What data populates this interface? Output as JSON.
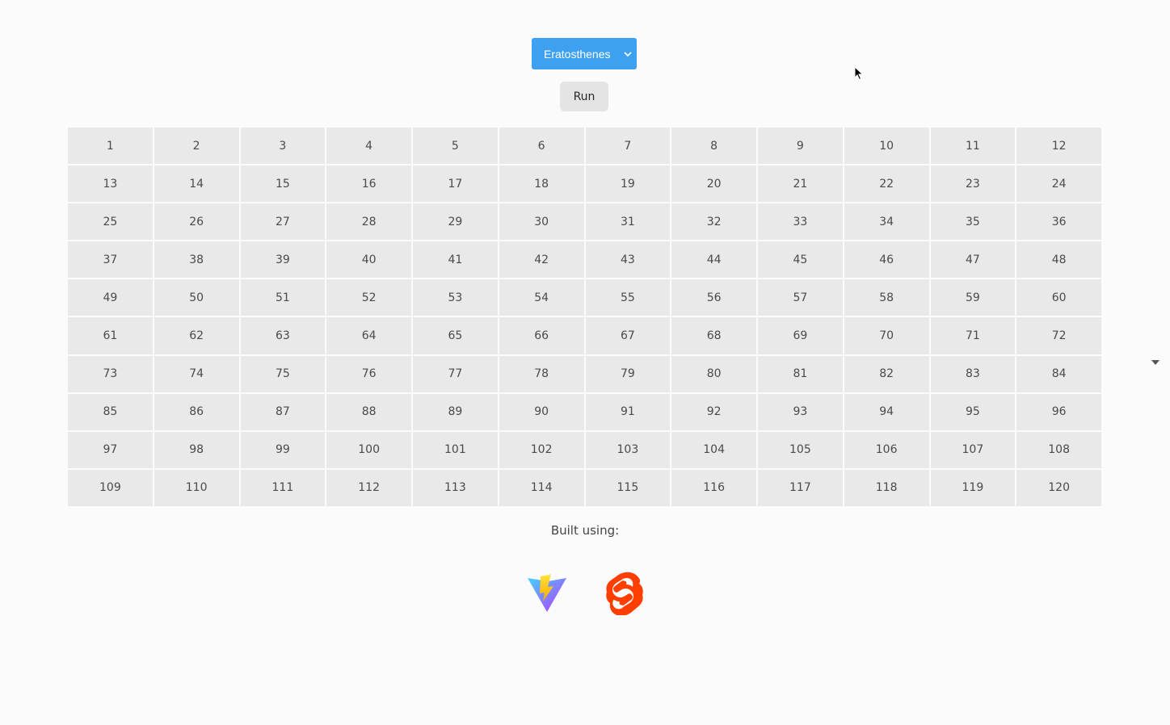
{
  "controls": {
    "algorithm_selected": "Eratosthenes",
    "run_label": "Run",
    "select_color": "#3da0f0"
  },
  "grid": {
    "numbers": [
      "1",
      "2",
      "3",
      "4",
      "5",
      "6",
      "7",
      "8",
      "9",
      "10",
      "11",
      "12",
      "13",
      "14",
      "15",
      "16",
      "17",
      "18",
      "19",
      "20",
      "21",
      "22",
      "23",
      "24",
      "25",
      "26",
      "27",
      "28",
      "29",
      "30",
      "31",
      "32",
      "33",
      "34",
      "35",
      "36",
      "37",
      "38",
      "39",
      "40",
      "41",
      "42",
      "43",
      "44",
      "45",
      "46",
      "47",
      "48",
      "49",
      "50",
      "51",
      "52",
      "53",
      "54",
      "55",
      "56",
      "57",
      "58",
      "59",
      "60",
      "61",
      "62",
      "63",
      "64",
      "65",
      "66",
      "67",
      "68",
      "69",
      "70",
      "71",
      "72",
      "73",
      "74",
      "75",
      "76",
      "77",
      "78",
      "79",
      "80",
      "81",
      "82",
      "83",
      "84",
      "85",
      "86",
      "87",
      "88",
      "89",
      "90",
      "91",
      "92",
      "93",
      "94",
      "95",
      "96",
      "97",
      "98",
      "99",
      "100",
      "101",
      "102",
      "103",
      "104",
      "105",
      "106",
      "107",
      "108",
      "109",
      "110",
      "111",
      "112",
      "113",
      "114",
      "115",
      "116",
      "117",
      "118",
      "119",
      "120"
    ]
  },
  "footer": {
    "built_using": "Built using:",
    "logos": [
      "vite-logo",
      "svelte-logo"
    ]
  }
}
